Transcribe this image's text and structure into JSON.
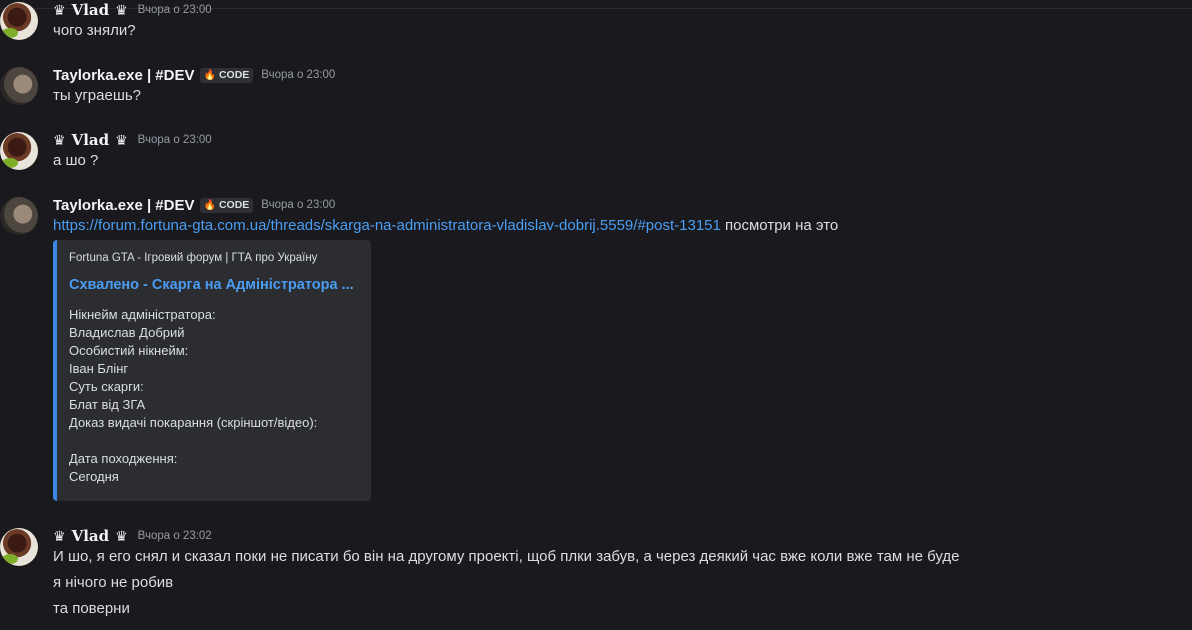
{
  "messages": [
    {
      "author": "Vlad",
      "timestamp": "Вчора о 23:00",
      "lines": [
        "чого зняли?"
      ]
    },
    {
      "author": "Taylorka.exe | #DEV",
      "tag": "CODE",
      "timestamp": "Вчора о 23:00",
      "lines": [
        "ты уграешь?"
      ]
    },
    {
      "author": "Vlad",
      "timestamp": "Вчора о 23:00",
      "lines": [
        "а шо ?"
      ]
    },
    {
      "author": "Taylorka.exe | #DEV",
      "tag": "CODE",
      "timestamp": "Вчора о 23:00",
      "link": "https://forum.fortuna-gta.com.ua/threads/skarga-na-administratora-vladislav-dobrij.5559/#post-13151",
      "link_suffix": "посмотри на это",
      "embed": {
        "provider": "Fortuna GTA - Ігровий форум | ГТА про Україну",
        "title": "Схвалено - Скарга на Адміністратора ...",
        "description": "Нікнейм адміністратора:\nВладислав Добрий\nОсобистий нікнейм:\nІван Блінг\nСуть скарги:\nБлат від ЗГА\nДоказ видачі покарання (скріншот/відео):\n\nДата походження:\nСегодня"
      }
    },
    {
      "author": "Vlad",
      "timestamp": "Вчора о 23:02",
      "lines": [
        "И шо, я его снял и сказал поки не писати бо він на другому проекті, щоб плки забув, а через деякий час вже коли вже там не буде",
        "я нічого не робив",
        "та поверни"
      ]
    }
  ],
  "icons": {
    "crown": "♛",
    "flame": "flame-icon"
  }
}
